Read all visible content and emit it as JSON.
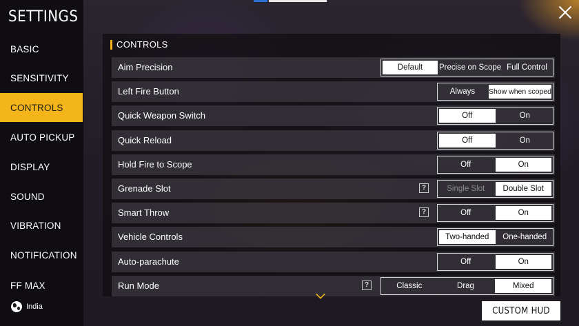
{
  "sidebar": {
    "title": "SETTINGS",
    "items": [
      {
        "label": "BASIC"
      },
      {
        "label": "SENSITIVITY"
      },
      {
        "label": "CONTROLS"
      },
      {
        "label": "AUTO PICKUP"
      },
      {
        "label": "DISPLAY"
      },
      {
        "label": "SOUND"
      },
      {
        "label": "VIBRATION"
      },
      {
        "label": "NOTIFICATION"
      },
      {
        "label": "FF MAX"
      }
    ],
    "active": "CONTROLS",
    "region": "India"
  },
  "section_title": "CONTROLS",
  "rows": [
    {
      "label": "Aim Precision",
      "options": [
        "Default",
        "Precise on Scope",
        "Full Control"
      ],
      "selected": 0
    },
    {
      "label": "Left Fire Button",
      "options": [
        "Always",
        "Show when scoped"
      ],
      "selected": 1
    },
    {
      "label": "Quick Weapon Switch",
      "options": [
        "Off",
        "On"
      ],
      "selected": 0
    },
    {
      "label": "Quick Reload",
      "options": [
        "Off",
        "On"
      ],
      "selected": 0
    },
    {
      "label": "Hold Fire to Scope",
      "options": [
        "Off",
        "On"
      ],
      "selected": 1
    },
    {
      "label": "Grenade Slot",
      "options": [
        "Single Slot",
        "Double Slot"
      ],
      "selected": 1,
      "help": "?"
    },
    {
      "label": "Smart Throw",
      "options": [
        "Off",
        "On"
      ],
      "selected": 1,
      "help": "?"
    },
    {
      "label": "Vehicle Controls",
      "options": [
        "Two-handed",
        "One-handed"
      ],
      "selected": 0
    },
    {
      "label": "Auto-parachute",
      "options": [
        "Off",
        "On"
      ],
      "selected": 1
    },
    {
      "label": "Run Mode",
      "options": [
        "Classic",
        "Drag",
        "Mixed"
      ],
      "selected": 2,
      "help": "?"
    }
  ],
  "custom_hud_label": "CUSTOM HUD",
  "colors": {
    "accent": "#f3b51a",
    "selected_option": "#ffffff"
  }
}
